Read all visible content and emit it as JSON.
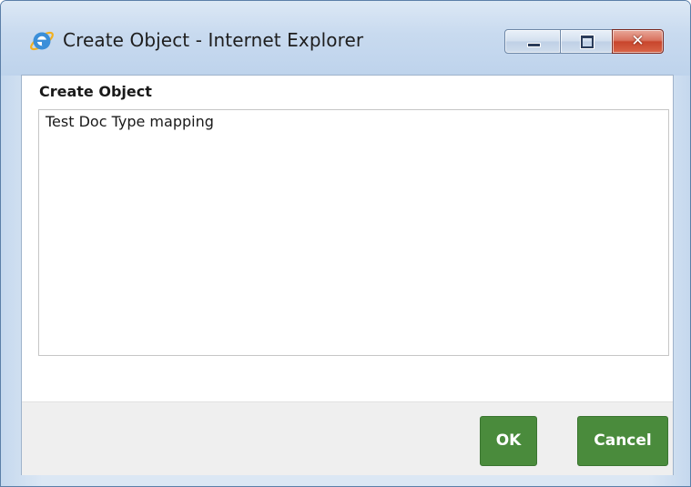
{
  "window": {
    "title": "Create Object - Internet Explorer",
    "icon": "internet-explorer-icon"
  },
  "controls": {
    "minimize_icon": "minimize-icon",
    "maximize_icon": "maximize-icon",
    "close_icon": "close-icon",
    "close_glyph": "✕"
  },
  "form": {
    "label": "Create Object",
    "textarea_value": "Test Doc Type mapping"
  },
  "buttons": {
    "ok_label": "OK",
    "cancel_label": "Cancel"
  },
  "colors": {
    "button_green": "#4a8b3c",
    "close_red": "#c8452c",
    "frame_blue": "#c8daef",
    "footer_gray": "#efefef"
  }
}
